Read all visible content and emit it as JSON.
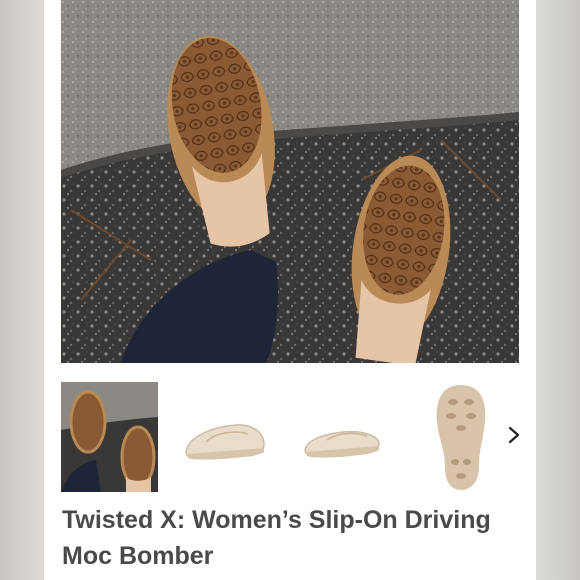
{
  "product": {
    "title": "Twisted X: Women’s Slip-On Driving Moc Bomber",
    "hero_image": "tooled-leather-slip-on-shoes-on-steps",
    "thumbnails": [
      {
        "name": "thumb-worn-photo",
        "selected": true
      },
      {
        "name": "thumb-side-view",
        "selected": false
      },
      {
        "name": "thumb-profile-view",
        "selected": false
      },
      {
        "name": "thumb-sole-view",
        "selected": false
      }
    ]
  },
  "icons": {
    "next": "chevron-right-icon"
  },
  "colors": {
    "title": "#4a4a4a",
    "leather": "#8a5a34",
    "suede": "#b98a55",
    "shoe_light": "#e9dccb",
    "sole": "#d8c3ab"
  }
}
